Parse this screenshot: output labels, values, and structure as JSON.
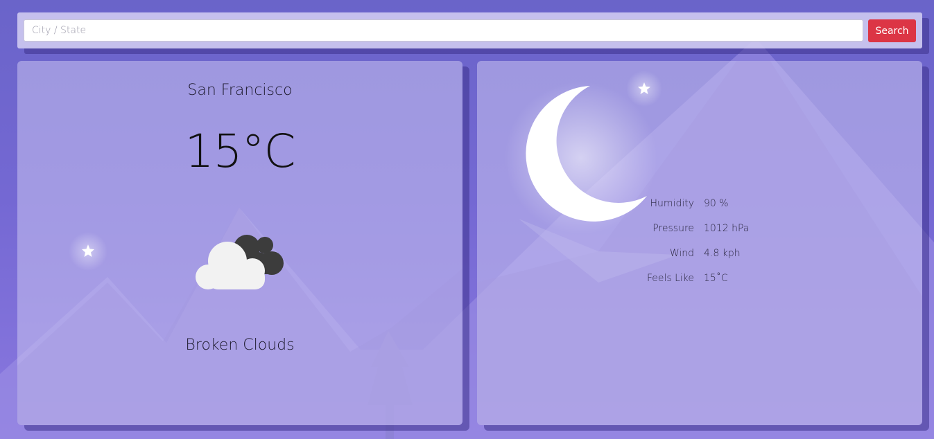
{
  "search": {
    "placeholder": "City / State",
    "value": "",
    "button_label": "Search"
  },
  "current": {
    "city": "San Francisco",
    "temperature": "15",
    "unit": "°C",
    "condition": "Broken Clouds",
    "icon": "broken-clouds-icon"
  },
  "details": [
    {
      "label": "Humidity",
      "value": "90 %"
    },
    {
      "label": "Pressure",
      "value": "1012 hPa"
    },
    {
      "label": "Wind",
      "value": "4.8 kph"
    },
    {
      "label": "Feels Like",
      "value": "15˚C"
    }
  ],
  "theme": {
    "accent": "#dc3545",
    "background": "#6a64c9",
    "card": "#b6b0e6"
  }
}
